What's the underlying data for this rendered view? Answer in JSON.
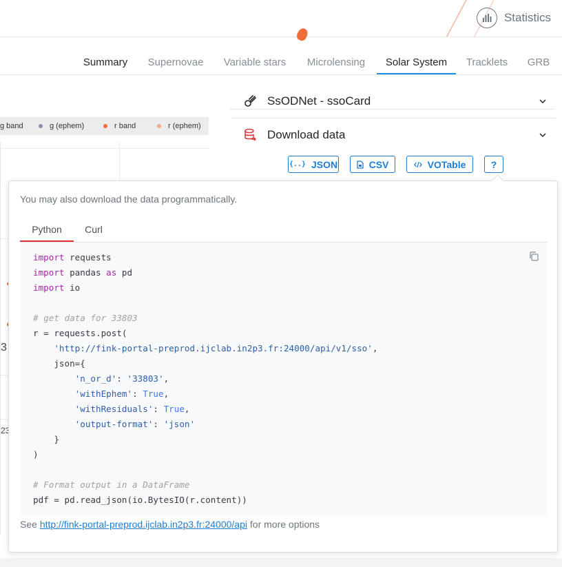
{
  "header": {
    "statistics_label": "Statistics"
  },
  "tabs": [
    {
      "label": "Summary"
    },
    {
      "label": "Supernovae"
    },
    {
      "label": "Variable stars"
    },
    {
      "label": "Microlensing"
    },
    {
      "label": "Solar System"
    },
    {
      "label": "Tracklets"
    },
    {
      "label": "GRB"
    }
  ],
  "active_tab": "Solar System",
  "legend": {
    "items": [
      {
        "label": "g band",
        "color": "#2e3f6e"
      },
      {
        "label": "g (ephem)",
        "color": "#8a8fb0"
      },
      {
        "label": "r band",
        "color": "#f06a3a"
      },
      {
        "label": "r (ephem)",
        "color": "#f5a58a"
      }
    ]
  },
  "plot": {
    "tick_fragment_1": "3",
    "tick_fragment_2": "23"
  },
  "accordion": {
    "ssodnet_title": "SsODNet - ssoCard",
    "download_title": "Download data"
  },
  "download": {
    "json_label": "JSON",
    "csv_label": "CSV",
    "votable_label": "VOTable",
    "help_label": "?"
  },
  "popover": {
    "intro": "You may also download the data programmatically.",
    "tabs": [
      {
        "label": "Python"
      },
      {
        "label": "Curl"
      }
    ],
    "active_code_tab": "Python",
    "code_lines": {
      "l1a": "import",
      "l1b": " requests",
      "l2a": "import",
      "l2b": " pandas ",
      "l2c": "as",
      "l2d": " pd",
      "l3a": "import",
      "l3b": " io",
      "l5": "# get data for 33803",
      "l6": "r = requests.post(",
      "l7a": "    ",
      "l7b": "'http://fink-portal-preprod.ijclab.in2p3.fr:24000/api/v1/sso'",
      "l7c": ",",
      "l8": "    json={",
      "l9a": "'n_or_d'",
      "l9b": ": ",
      "l9c": "'33803'",
      "l9d": ",",
      "l10a": "'withEphem'",
      "l10b": ": ",
      "l10c": "True",
      "l10d": ",",
      "l11a": "'withResiduals'",
      "l11b": ": ",
      "l11c": "True",
      "l11d": ",",
      "l12a": "'output-format'",
      "l12b": ": ",
      "l12c": "'json'",
      "l13": "    }",
      "l14": ")",
      "l16": "# Format output in a DataFrame",
      "l17": "pdf = pd.read_json(io.BytesIO(r.content))"
    },
    "footer_prefix": "See ",
    "footer_link": "http://fink-portal-preprod.ijclab.in2p3.fr:24000/api",
    "footer_suffix": " for more options"
  }
}
